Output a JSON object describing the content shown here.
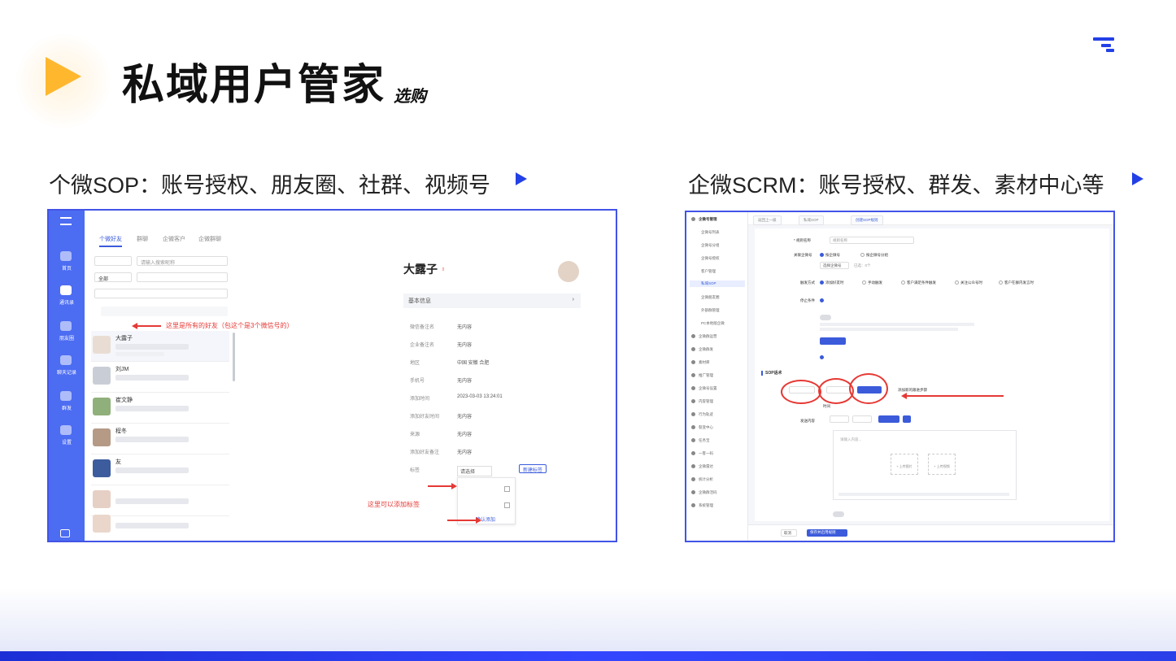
{
  "slide": {
    "title": "私域用户管家",
    "subtitle": "选购",
    "left_heading": "个微SOP：账号授权、朋友圈、社群、视频号",
    "right_heading": "企微SCRM：账号授权、群发、素材中心等"
  },
  "left_screenshot": {
    "tabs": [
      "个微好友",
      "群聊",
      "企微客户",
      "企微群聊"
    ],
    "filter_select": "全部",
    "filter_search_placeholder": "请输入搜索昵称",
    "annotation_friends": "这里是所有的好友（包这个是3个微信号的）",
    "annotation_tags": "这里可以添加标签",
    "contacts": [
      {
        "name": "大露子"
      },
      {
        "name": "刘JM"
      },
      {
        "name": "崔文静"
      },
      {
        "name": "程冬"
      },
      {
        "name": "友"
      },
      {
        "name": ""
      },
      {
        "name": ""
      }
    ],
    "detail": {
      "name": "大露子",
      "section": "基本信息",
      "rows": [
        {
          "k": "微信备注名",
          "v": "无内容"
        },
        {
          "k": "企业备注名",
          "v": "无内容"
        },
        {
          "k": "地区",
          "v": "中国 安徽 合肥"
        },
        {
          "k": "手机号",
          "v": "无内容"
        },
        {
          "k": "添加时间",
          "v": "2023-03-03 13:24:01"
        },
        {
          "k": "添加好友时间",
          "v": "无内容"
        },
        {
          "k": "来源",
          "v": "无内容"
        },
        {
          "k": "添加好友备注",
          "v": "无内容"
        },
        {
          "k": "标签",
          "v": "请选择"
        }
      ],
      "tag_button": "新建标签",
      "confirm": "确认添加"
    },
    "sidebar": [
      "首页",
      "通讯录",
      "朋友圈",
      "聊天记录",
      "群发",
      "设置"
    ]
  },
  "right_screenshot": {
    "crumbs": [
      "返回上一级",
      "私域SOP",
      "创建SOP规则"
    ],
    "sidebar": [
      "企微号管理",
      "企微号列表",
      "企微号分组",
      "企微号授权",
      "客户管理",
      "私域SOP",
      "企微朋友圈",
      "外部群管理",
      "PC本地版企微",
      "企微群运营",
      "企微群发",
      "素材库",
      "推广管理",
      "企微号设置",
      "内容管理",
      "行为轨迹",
      "裂变中心",
      "任务宝",
      "一客一码",
      "企微雷达",
      "统计分析",
      "企微群活码",
      "系统管理"
    ],
    "form": {
      "rule_name_label": "* 规则名称",
      "rule_name_value": "规则名称",
      "account_label": "关联企微号",
      "account_opt1": "按企微号",
      "account_opt2": "按企微号分组",
      "select_account": "选择企微号",
      "selected_count": "已选：0个",
      "trigger_label": "触发方式",
      "trigger_opts": [
        "添加好友时",
        "手动触发",
        "客户满足条件触发",
        "关注公众号时",
        "客户在群内发言时"
      ],
      "stop_label": "停止条件",
      "sop_title": "SOP话术",
      "time_label": "时间",
      "content_label": "发送内容",
      "editor_placeholder": "请输入内容...",
      "upload1": "+ 上传图片",
      "upload2": "+ 上传视频",
      "note": "添加新的跟进步骤",
      "cancel": "取消",
      "save": "保存并启用规则"
    }
  },
  "colors": {
    "accent": "#2340e6",
    "play": "#ffb72e",
    "annotation": "#e53935"
  }
}
